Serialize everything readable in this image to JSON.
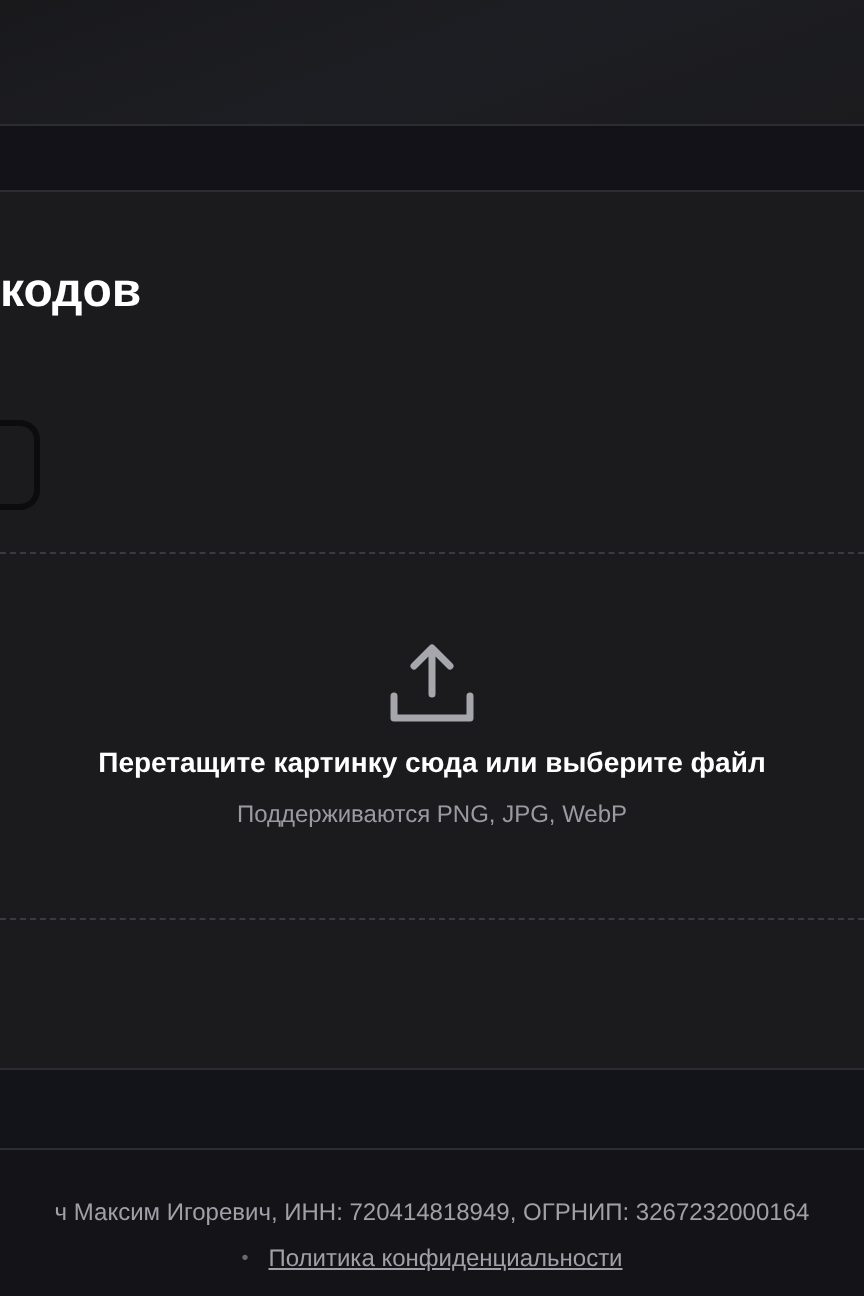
{
  "section_title": "кодов",
  "code_field": {
    "kind": "input"
  },
  "dropzone": {
    "title": "Перетащите картинку сюда или выберите файл",
    "hint": "Поддерживаются PNG, JPG, WebP"
  },
  "footer": {
    "legal": "ч Максим Игоревич, ИНН: 720414818949, ОГРНИП: 3267232000164",
    "bullet": "•",
    "privacy_link": "Политика конфиденциальности"
  }
}
